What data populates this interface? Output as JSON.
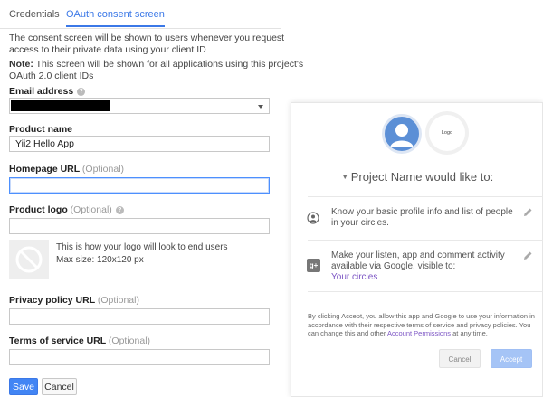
{
  "tabs": [
    {
      "label": "Credentials",
      "active": false
    },
    {
      "label": "OAuth consent screen",
      "active": true
    }
  ],
  "description": "The consent screen will be shown to users whenever you request access to their private data using your client ID",
  "note": {
    "label": "Note:",
    "text": " This screen will be shown for all applications using this project's OAuth 2.0 client IDs"
  },
  "form": {
    "email": {
      "label": "Email address",
      "value": ""
    },
    "product_name": {
      "label": "Product name",
      "value": "Yii2 Hello App"
    },
    "homepage_url": {
      "label": "Homepage URL",
      "optional": "(Optional)",
      "value": ""
    },
    "product_logo": {
      "label": "Product logo",
      "optional": "(Optional)",
      "value": "",
      "hint": "This is how your logo will look to end users",
      "size": "Max size: 120x120 px"
    },
    "privacy_url": {
      "label": "Privacy policy URL",
      "optional": "(Optional)",
      "value": ""
    },
    "tos_url": {
      "label": "Terms of service URL",
      "optional": "(Optional)",
      "value": ""
    }
  },
  "buttons": {
    "save": "Save",
    "cancel": "Cancel"
  },
  "preview": {
    "logo_label": "Logo",
    "title": "Project Name would like to:",
    "permissions": [
      {
        "icon": "profile-icon",
        "text": "Know your basic profile info and list of people in your circles."
      },
      {
        "icon": "google-plus-icon",
        "text": "Make your listen, app and comment activity available via Google, visible to:",
        "link": "Your circles"
      }
    ],
    "legal": {
      "text": "By clicking Accept, you allow this app and Google to use your information in accordance with their respective terms of service and privacy policies. You can change this and other ",
      "link": "Account Permissions",
      "suffix": " at any time."
    },
    "cancel": "Cancel",
    "accept": "Accept"
  },
  "colors": {
    "accent": "#4285f4",
    "link": "#7c55c4"
  }
}
